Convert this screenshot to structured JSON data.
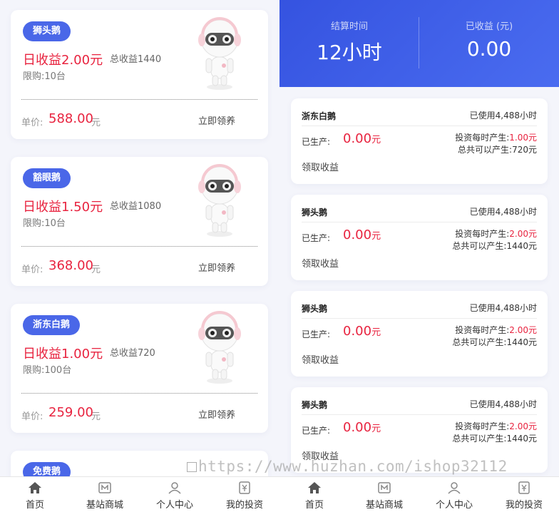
{
  "products": [
    {
      "name": "狮头鹅",
      "daily": "日收益2.00元",
      "total": "总收益1440",
      "limit": "限购:10台",
      "price_label": "单价:",
      "price": "588.00",
      "unit": "元",
      "action": "立即领养"
    },
    {
      "name": "豁眼鹅",
      "daily": "日收益1.50元",
      "total": "总收益1080",
      "limit": "限购:10台",
      "price_label": "单价:",
      "price": "368.00",
      "unit": "元",
      "action": "立即领养"
    },
    {
      "name": "浙东白鹅",
      "daily": "日收益1.00元",
      "total": "总收益720",
      "limit": "限购:100台",
      "price_label": "单价:",
      "price": "259.00",
      "unit": "元",
      "action": "立即领养"
    },
    {
      "name": "免费鹅"
    }
  ],
  "summary": {
    "settle_label": "结算时间",
    "settle_value": "12小时",
    "earned_label": "已收益 (元)",
    "earned_value": "0.00"
  },
  "investments": [
    {
      "name": "浙东白鹅",
      "used": "已使用4,488小时",
      "produced_label": "已生产:",
      "produced": "0.00",
      "produced_unit": "元",
      "hourly_label": "投资每时产生:",
      "hourly": "1.00元",
      "total_label": "总共可以产生:",
      "total": "720元",
      "collect": "领取收益"
    },
    {
      "name": "狮头鹅",
      "used": "已使用4,488小时",
      "produced_label": "已生产:",
      "produced": "0.00",
      "produced_unit": "元",
      "hourly_label": "投资每时产生:",
      "hourly": "2.00元",
      "total_label": "总共可以产生:",
      "total": "1440元",
      "collect": "领取收益"
    },
    {
      "name": "狮头鹅",
      "used": "已使用4,488小时",
      "produced_label": "已生产:",
      "produced": "0.00",
      "produced_unit": "元",
      "hourly_label": "投资每时产生:",
      "hourly": "2.00元",
      "total_label": "总共可以产生:",
      "total": "1440元",
      "collect": "领取收益"
    },
    {
      "name": "狮头鹅",
      "used": "已使用4,488小时",
      "produced_label": "已生产:",
      "produced": "0.00",
      "produced_unit": "元",
      "hourly_label": "投资每时产生:",
      "hourly": "2.00元",
      "total_label": "总共可以产生:",
      "total": "1440元",
      "collect": "领取收益"
    }
  ],
  "nav": [
    {
      "label": "首页",
      "icon": "home-icon"
    },
    {
      "label": "基站商城",
      "icon": "store-icon"
    },
    {
      "label": "个人中心",
      "icon": "user-icon"
    },
    {
      "label": "我的投资",
      "icon": "investment-icon"
    }
  ],
  "watermark": "https://www.huzhan.com/ishop32112",
  "colors": {
    "accent": "#4a67e8",
    "price_red": "#e8233f",
    "hero_blue": "#3553e0"
  }
}
